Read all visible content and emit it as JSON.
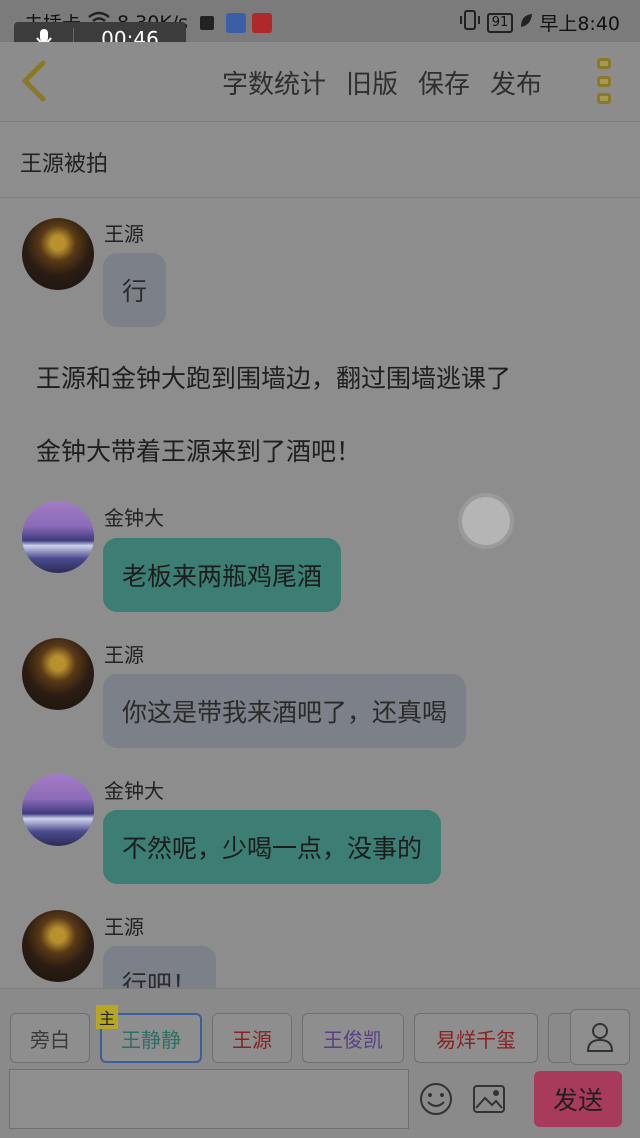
{
  "status_bar": {
    "carrier": "未插卡",
    "speed": "8.30K/s",
    "battery": "91",
    "time": "早上8:40",
    "recording_time": "00:46"
  },
  "toolbar": {
    "actions": [
      "字数统计",
      "旧版",
      "保存",
      "发布"
    ]
  },
  "story": {
    "title": "王源被拍"
  },
  "chat": {
    "messages": [
      {
        "sender": "王源",
        "text": "行"
      },
      {
        "narration": "王源和金钟大跑到围墙边，翻过围墙逃课了"
      },
      {
        "narration": "金钟大带着王源来到了酒吧！"
      },
      {
        "sender": "金钟大",
        "text": "老板来两瓶鸡尾酒"
      },
      {
        "sender": "王源",
        "text": "你这是带我来酒吧了，还真喝"
      },
      {
        "sender": "金钟大",
        "text": "不然呢，少喝一点，没事的"
      },
      {
        "sender": "王源",
        "text": "行吧！"
      }
    ]
  },
  "roles": {
    "items": [
      "旁白",
      "王静静",
      "王源",
      "王俊凯",
      "易烊千玺"
    ],
    "main_badge": "主",
    "colors": {
      "旁白": "#3a3a3a",
      "王静静": "#2e6f66",
      "王源": "#8a2020",
      "王俊凯": "#5a3f86",
      "易烊千玺": "#8a2020"
    }
  },
  "input": {
    "placeholder": "",
    "send_label": "发送"
  },
  "colors": {
    "bubble_gray": "#7c8088",
    "bubble_green": "#3c7e73",
    "send_button": "#a83b5b",
    "accent_yellow": "#8a7a28"
  }
}
